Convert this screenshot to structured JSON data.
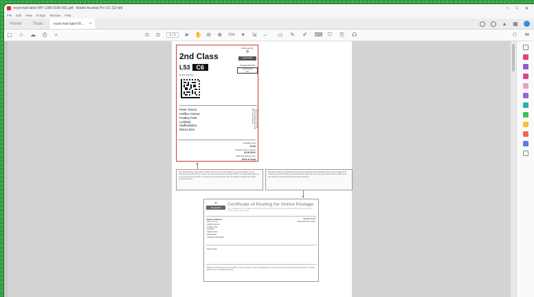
{
  "window": {
    "title": "royal-mail-label-WP-1285-6036-001.pdf - Adobe Acrobat Pro DC (32-bit)",
    "menu": [
      "File",
      "Edit",
      "View",
      "E-Sign",
      "Window",
      "Help"
    ],
    "controls": [
      "–",
      "□",
      "✕"
    ]
  },
  "tabs": {
    "home": "Home",
    "tools": "Tools",
    "document": "royal-mail-label-W...",
    "close": "×"
  },
  "toolbar": {
    "page_indicator": "1 / 1",
    "zoom": "71%"
  },
  "label": {
    "service_class": "2nd Class",
    "delivered_by": "Delivered By",
    "royal_mail": "Royal Mail",
    "postage_paid": "Postage Paid GB",
    "route_code": "L53",
    "route_sub": "C6",
    "weight_header": "Small Parcel",
    "weight_value": "2kg",
    "reference": "H AC3 2YE W2",
    "address_lines": [
      "Peter Timms",
      "Halifax Avenue",
      "Fradley Park",
      "Lichfield",
      "Staffordshire",
      "WS13 8SS"
    ],
    "vertical_text": "Return Address Royal Mail Lichfield Staffordshire WS13 8SS United Kingdom",
    "postage_cost_label": "Postage Cost",
    "postage_cost": "£3.80",
    "posted_label": "Posted on the week of",
    "posted_date": "20.02.2021",
    "payment_label": "Paid and printed from",
    "payment_value": "Click & Drop"
  },
  "instructions": {
    "left": "Print this label onto a plain piece of paper, and then cut out and attach to your parcel. Make sure all barcodes are visible and not covered. You can post your item at a Post Office®, in a Royal Mail postbox or at a Customer Service Point. If you have any questions please visit our website or contact Royal Mail customer services.",
    "right": "Take this certificate of posting with you and get it stamped at the Post Office® as proof of postage. This certificate is your proof that you posted the item, which you may need if you wish to make a claim. Keep this certificate safe until your item has been delivered."
  },
  "certificate": {
    "title": "Certificate of Posting for Online Postage",
    "subtitle": "This certificate will not be valid unless stamped by a staff member. Keep this certificate safe in case you need to make a compensation claim.",
    "name_header": "Name & Address",
    "address_lines": [
      "Peter Timms",
      "Halifax Avenue",
      "Fradley Park",
      "Lichfield",
      "Staffordshire",
      "WS13 8SS",
      "UNITED KINGDOM"
    ],
    "service_header": "Service Used",
    "service_value": "Royal Mail 2nd Class",
    "other_items": "Other Items:",
    "footer": "Subject to Royal Mail terms and conditions. This is not a VAT receipt. Royal Mail and the cruciform are trade marks of Royal Mail Group Ltd. © Royal Mail Group Ltd. All Rights Reserved."
  },
  "colors": {
    "label_border": "#c83737",
    "desktop": "#2f9e44",
    "canvas": "#d3d3d3"
  }
}
